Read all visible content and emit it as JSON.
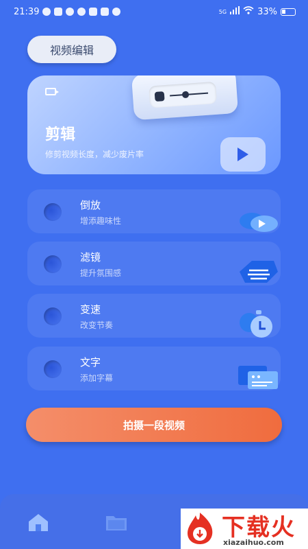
{
  "status_bar": {
    "time": "21:39",
    "network": "5G",
    "battery": "33%"
  },
  "header": {
    "tab_label": "视频编辑"
  },
  "hero": {
    "title": "剪辑",
    "subtitle": "修剪视频长度，减少废片率"
  },
  "features": [
    {
      "title": "倒放",
      "subtitle": "增添趣味性",
      "icon": "cloud-play-icon"
    },
    {
      "title": "滤镜",
      "subtitle": "提升氛围感",
      "icon": "filter-layers-icon"
    },
    {
      "title": "变速",
      "subtitle": "改变节奏",
      "icon": "speed-clock-icon"
    },
    {
      "title": "文字",
      "subtitle": "添加字幕",
      "icon": "subtitle-text-icon"
    }
  ],
  "record_button": {
    "label": "拍摄一段视频"
  },
  "bottom_nav": {
    "items": [
      {
        "icon": "home-icon",
        "active": true
      },
      {
        "icon": "folder-icon",
        "active": false
      }
    ]
  },
  "watermark": {
    "text": "下载火",
    "url": "xiazaihuo.com"
  },
  "colors": {
    "background": "#3f6ff0",
    "accent_orange": "#f06c3e",
    "tab_bg": "#e9edf7"
  }
}
